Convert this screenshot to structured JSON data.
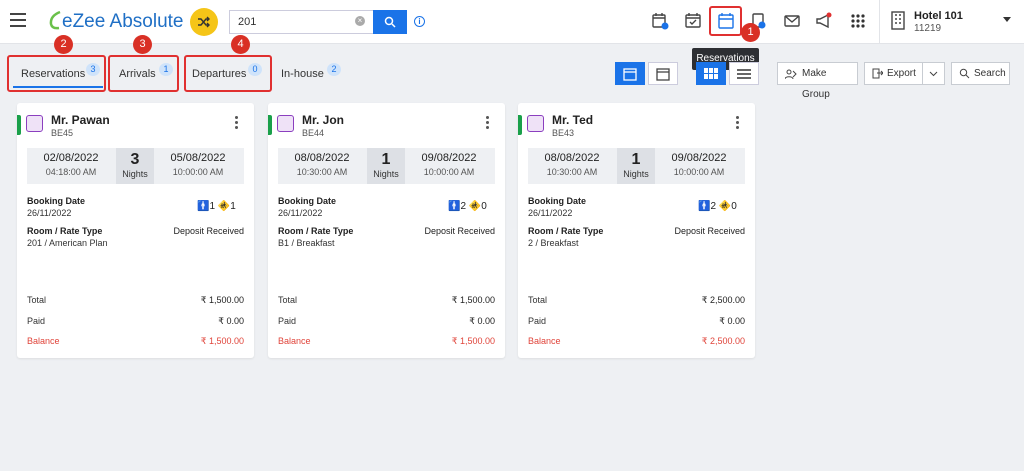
{
  "header": {
    "logo_text": "eZee Absolute",
    "search_value": "201",
    "info_icon": "info-icon",
    "tooltip": "Reservations",
    "hotel_name": "Hotel 101",
    "hotel_id": "11219",
    "annotation_1": "1"
  },
  "tabs": [
    {
      "label": "Reservations",
      "count": "3",
      "annotation": "2"
    },
    {
      "label": "Arrivals",
      "count": "1",
      "annotation": "3"
    },
    {
      "label": "Departures",
      "count": "0",
      "annotation": "4"
    },
    {
      "label": "In-house",
      "count": "2"
    }
  ],
  "toolbar": {
    "make_group": "Make Group",
    "export": "Export",
    "search": "Search"
  },
  "colors": {
    "accent": "#1a73e8",
    "annotation": "#e03030",
    "balance": "#e0443a",
    "status": "#1aa04a"
  },
  "cards": [
    {
      "guest": "Mr. Pawan",
      "code": "BE45",
      "arrival_date": "02/08/2022",
      "arrival_time": "04:18:00 AM",
      "nights": "3",
      "nights_label": "Nights",
      "departure_date": "05/08/2022",
      "departure_time": "10:00:00 AM",
      "booking_label": "Booking Date",
      "booking_date": "26/11/2022",
      "adults": "1",
      "children": "1",
      "room_label": "Room / Rate Type",
      "room": "201 / American Plan",
      "deposit": "Deposit Received",
      "total_label": "Total",
      "total": "₹ 1,500.00",
      "paid_label": "Paid",
      "paid": "₹ 0.00",
      "balance_label": "Balance",
      "balance": "₹ 1,500.00"
    },
    {
      "guest": "Mr. Jon",
      "code": "BE44",
      "arrival_date": "08/08/2022",
      "arrival_time": "10:30:00 AM",
      "nights": "1",
      "nights_label": "Nights",
      "departure_date": "09/08/2022",
      "departure_time": "10:00:00 AM",
      "booking_label": "Booking Date",
      "booking_date": "26/11/2022",
      "adults": "2",
      "children": "0",
      "room_label": "Room / Rate Type",
      "room": "B1 / Breakfast",
      "deposit": "Deposit Received",
      "total_label": "Total",
      "total": "₹ 1,500.00",
      "paid_label": "Paid",
      "paid": "₹ 0.00",
      "balance_label": "Balance",
      "balance": "₹ 1,500.00"
    },
    {
      "guest": "Mr. Ted",
      "code": "BE43",
      "arrival_date": "08/08/2022",
      "arrival_time": "10:30:00 AM",
      "nights": "1",
      "nights_label": "Nights",
      "departure_date": "09/08/2022",
      "departure_time": "10:00:00 AM",
      "booking_label": "Booking Date",
      "booking_date": "26/11/2022",
      "adults": "2",
      "children": "0",
      "room_label": "Room / Rate Type",
      "room": "2 / Breakfast",
      "deposit": "Deposit Received",
      "total_label": "Total",
      "total": "₹ 2,500.00",
      "paid_label": "Paid",
      "paid": "₹ 0.00",
      "balance_label": "Balance",
      "balance": "₹ 2,500.00"
    }
  ]
}
